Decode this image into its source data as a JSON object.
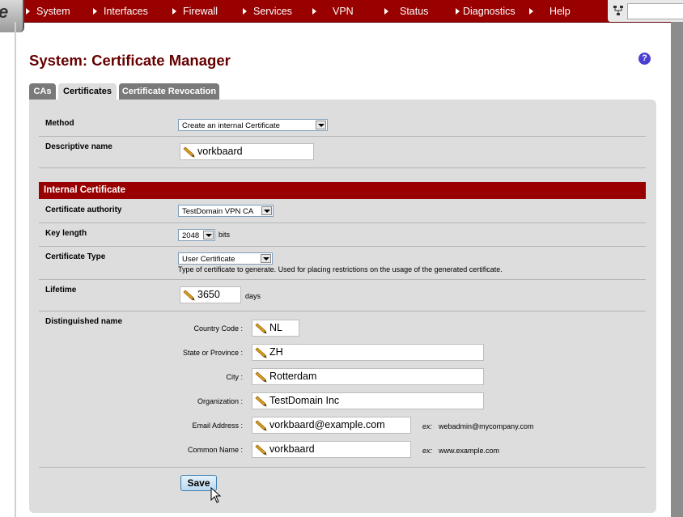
{
  "nav": {
    "logo_text": "e",
    "items": [
      {
        "label": "System"
      },
      {
        "label": "Interfaces"
      },
      {
        "label": "Firewall"
      },
      {
        "label": "Services"
      },
      {
        "label": "VPN"
      },
      {
        "label": "Status"
      },
      {
        "label": "Diagnostics"
      },
      {
        "label": "Help"
      }
    ],
    "search_value": ""
  },
  "page": {
    "title": "System: Certificate Manager",
    "help_symbol": "?"
  },
  "tabs": [
    {
      "label": "CAs",
      "active": false
    },
    {
      "label": "Certificates",
      "active": true
    },
    {
      "label": "Certificate Revocation",
      "active": false
    }
  ],
  "form": {
    "method": {
      "label": "Method",
      "value": "Create an internal Certificate"
    },
    "descriptive_name": {
      "label": "Descriptive name",
      "value": "vorkbaard"
    },
    "section_title": "Internal Certificate",
    "ca": {
      "label": "Certificate authority",
      "value": "TestDomain VPN CA"
    },
    "key_length": {
      "label": "Key length",
      "value": "2048",
      "unit": "bits"
    },
    "cert_type": {
      "label": "Certificate Type",
      "value": "User Certificate",
      "help": "Type of certificate to generate. Used for placing restrictions on the usage of the generated certificate."
    },
    "lifetime": {
      "label": "Lifetime",
      "value": "3650",
      "unit": "days"
    },
    "dn": {
      "label": "Distinguished name",
      "country": {
        "label": "Country Code :",
        "value": "NL"
      },
      "state": {
        "label": "State or Province :",
        "value": "ZH"
      },
      "city": {
        "label": "City :",
        "value": "Rotterdam"
      },
      "org": {
        "label": "Organization :",
        "value": "TestDomain Inc"
      },
      "email": {
        "label": "Email Address :",
        "value": "vorkbaard@example.com",
        "ex_prefix": "ex:",
        "ex": "webadmin@mycompany.com"
      },
      "cn": {
        "label": "Common Name :",
        "value": "vorkbaard",
        "ex_prefix": "ex:",
        "ex": "www.example.com"
      }
    },
    "save_label": "Save"
  },
  "colors": {
    "nav_bg": "#990000",
    "title": "#660000",
    "panel": "#dddddd",
    "help": "#4a3fd0"
  }
}
